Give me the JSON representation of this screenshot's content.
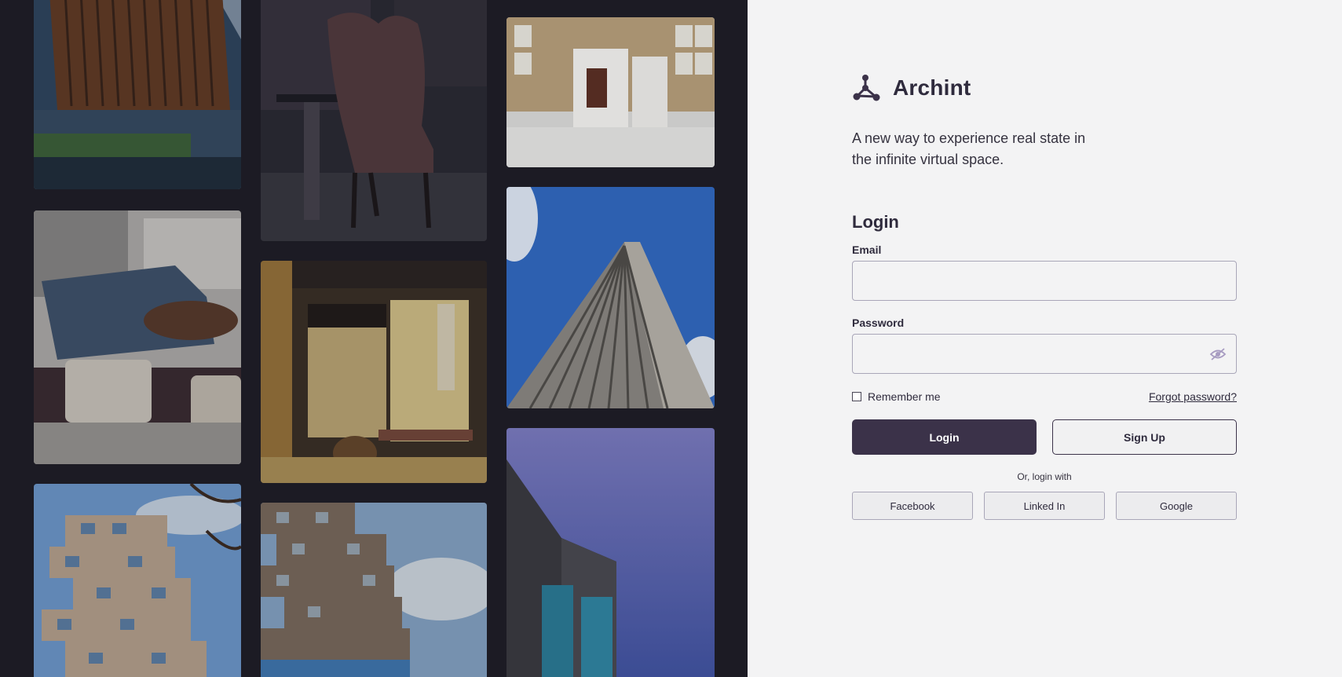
{
  "brand": {
    "name": "Archint",
    "icon": "molecule-logo-icon"
  },
  "tagline": "A new way to experience real state in the infinite virtual space.",
  "login": {
    "title": "Login",
    "email_label": "Email",
    "email_value": "",
    "password_label": "Password",
    "password_value": "",
    "password_toggle_icon": "eye-slash-icon",
    "remember_label": "Remember me",
    "remember_checked": false,
    "forgot_label": "Forgot password?",
    "login_button": "Login",
    "signup_button": "Sign Up",
    "or_text": "Or, login with",
    "social": [
      "Facebook",
      "Linked In",
      "Google"
    ]
  },
  "colors": {
    "gallery_bg": "#1c1b24",
    "panel_bg": "#f3f3f4",
    "primary": "#3b3249",
    "text": "#2f2b3d",
    "border": "#a9a6b8"
  }
}
